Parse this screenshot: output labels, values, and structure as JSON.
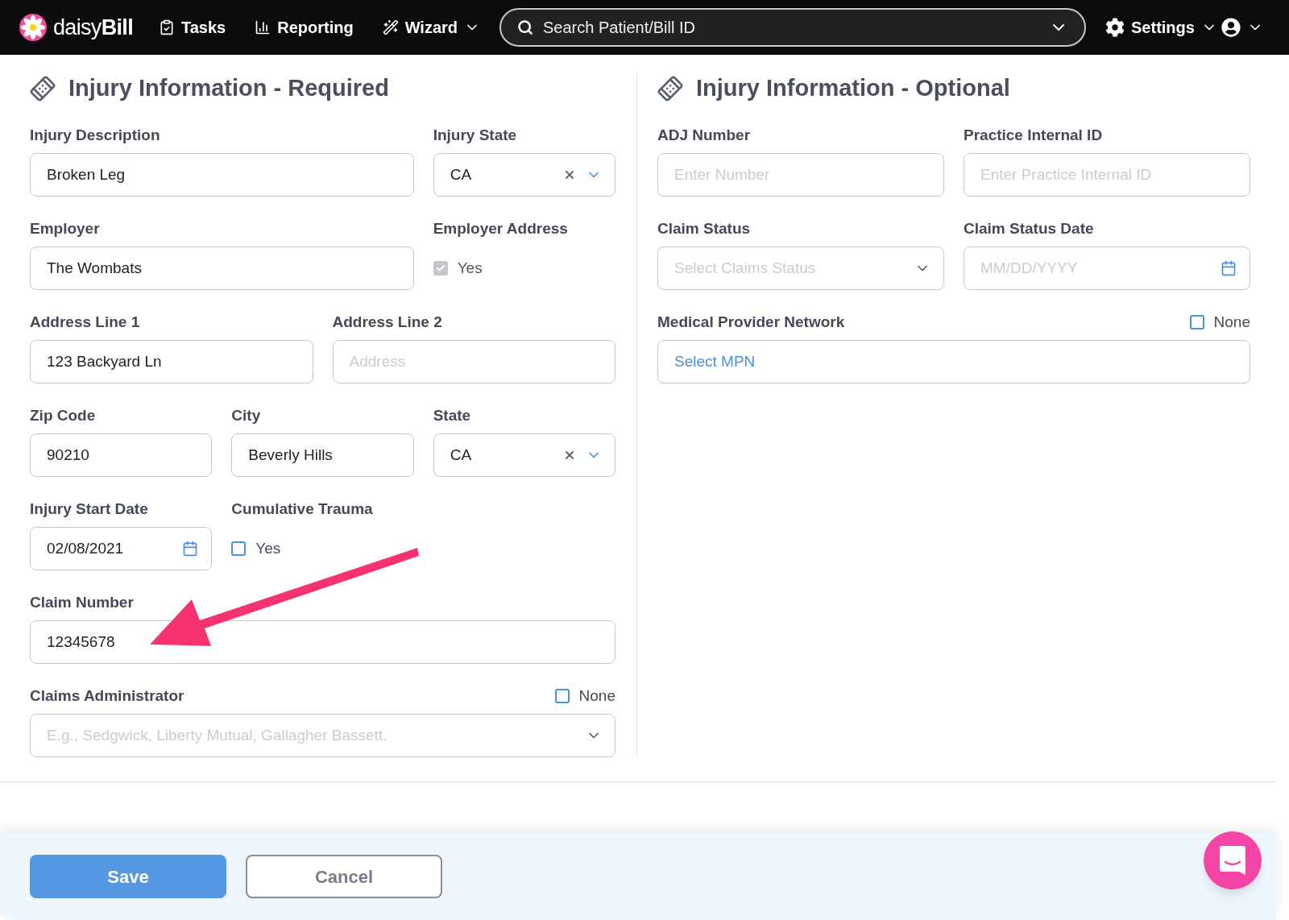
{
  "nav": {
    "logo": "daisy",
    "logo_bold": "Bill",
    "items": [
      {
        "kind": "tasks",
        "label": "Tasks",
        "dropdown": false
      },
      {
        "kind": "reporting",
        "label": "Reporting",
        "dropdown": false
      },
      {
        "kind": "wizard",
        "label": "Wizard",
        "dropdown": true
      }
    ],
    "search": {
      "placeholder": "Search Patient/Bill ID"
    },
    "settings": {
      "label": "Settings"
    }
  },
  "sections": [
    {
      "title": "Injury Information - Required",
      "rows": [
        [
          {
            "kind": "text",
            "label": "Injury Description",
            "value": "Broken Leg"
          },
          {
            "kind": "select",
            "label": "Injury State",
            "value": "CA",
            "clearable": true
          }
        ],
        [
          {
            "kind": "text",
            "label": "Employer",
            "value": "The Wombats"
          },
          {
            "kind": "checkbox",
            "label": "Employer Address",
            "option": "Yes",
            "checked": true,
            "disabled": true
          }
        ],
        [
          {
            "kind": "text",
            "label": "Address Line 1",
            "value": "123 Backyard Ln"
          },
          {
            "kind": "text",
            "label": "Address Line 2",
            "placeholder": "Address"
          }
        ],
        [
          {
            "kind": "text",
            "label": "Zip Code",
            "value": "90210"
          },
          {
            "kind": "text",
            "label": "City",
            "value": "Beverly Hills"
          },
          {
            "kind": "select",
            "label": "State",
            "value": "CA",
            "clearable": true
          }
        ],
        [
          {
            "kind": "date",
            "label": "Injury Start Date",
            "value": "02/08/2021"
          },
          {
            "kind": "checkbox",
            "label": "Cumulative Trauma",
            "option": "Yes",
            "checked": false,
            "disabled": false
          }
        ],
        [
          {
            "kind": "text",
            "label": "Claim Number",
            "value": "12345678"
          }
        ],
        [
          {
            "kind": "select",
            "label": "Claims Administrator",
            "placeholder": "E.g., Sedgwick, Liberty Mutual, Gallagher Bassett.",
            "clearable": false,
            "none": {
              "label": "None",
              "checked": false
            }
          }
        ]
      ]
    },
    {
      "title": "Injury Information - Optional",
      "rows": [
        [
          {
            "kind": "text",
            "label": "ADJ Number",
            "placeholder": "Enter Number"
          },
          {
            "kind": "text",
            "label": "Practice Internal ID",
            "placeholder": "Enter Practice Internal ID"
          }
        ],
        [
          {
            "kind": "select",
            "label": "Claim Status",
            "placeholder": "Select Claims Status",
            "clearable": false
          },
          {
            "kind": "date",
            "label": "Claim Status Date",
            "placeholder": "MM/DD/YYYY"
          }
        ],
        [
          {
            "kind": "link",
            "label": "Medical Provider Network",
            "value": "Select MPN",
            "none": {
              "label": "None",
              "checked": false
            }
          }
        ]
      ]
    }
  ],
  "footer": {
    "save": "Save",
    "cancel": "Cancel"
  }
}
